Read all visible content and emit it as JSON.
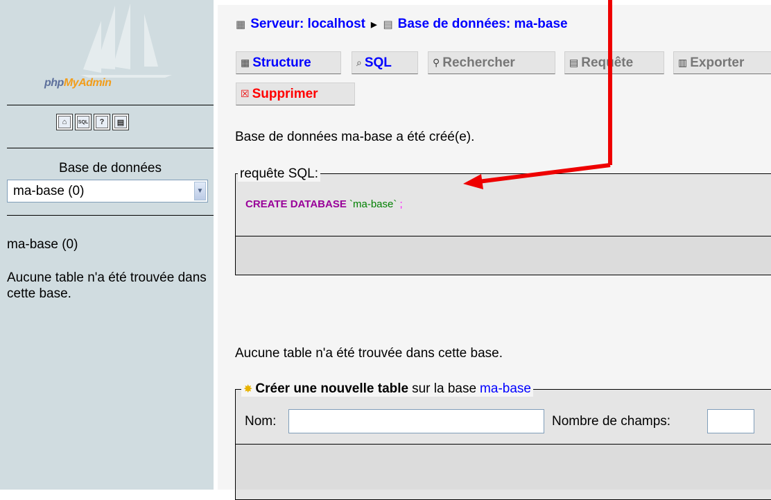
{
  "left": {
    "logo_text_part1": "php",
    "logo_text_part2": "My",
    "logo_text_part3": "Admin",
    "icons": [
      "home-icon",
      "sql-query-icon",
      "help-icon",
      "query-window-icon"
    ],
    "icon_glyphs": [
      "⌂",
      "SQL",
      "?",
      "▤"
    ],
    "db_label": "Base de données",
    "db_select_value": "ma-base (0)",
    "db_name": "ma-base (0)",
    "no_tables_message": "Aucune table n'a été trouvée dans cette base."
  },
  "breadcrumb": {
    "server": "Serveur: localhost",
    "database": "Base de données: ma-base"
  },
  "tabs": [
    {
      "label": "Structure",
      "icon": "structure-icon"
    },
    {
      "label": "SQL",
      "icon": "sql-icon"
    },
    {
      "label": "Rechercher",
      "icon": "search-icon"
    },
    {
      "label": "Requête",
      "icon": "query-icon"
    },
    {
      "label": "Exporter",
      "icon": "export-icon"
    },
    {
      "label": "Supprimer",
      "icon": "drop-icon"
    }
  ],
  "main": {
    "created_message": "Base de données ma-base a été créé(e).",
    "sql_legend": "requête SQL:",
    "sql_keyword": "CREATE DATABASE",
    "sql_name": "`ma-base`",
    "sql_semicolon": ";",
    "no_tables_message": "Aucune table n'a été trouvée dans cette base.",
    "create_table": {
      "legend_bold": "Créer une nouvelle table",
      "legend_text": "sur la base",
      "legend_link": "ma-base",
      "name_label": "Nom:",
      "name_value": "",
      "fields_label": "Nombre de champs:",
      "fields_value": ""
    }
  },
  "colors": {
    "link": "#0000ff",
    "danger": "#ff0000",
    "annotation_arrow": "#ee0000",
    "nav_background": "#d0dce0"
  }
}
